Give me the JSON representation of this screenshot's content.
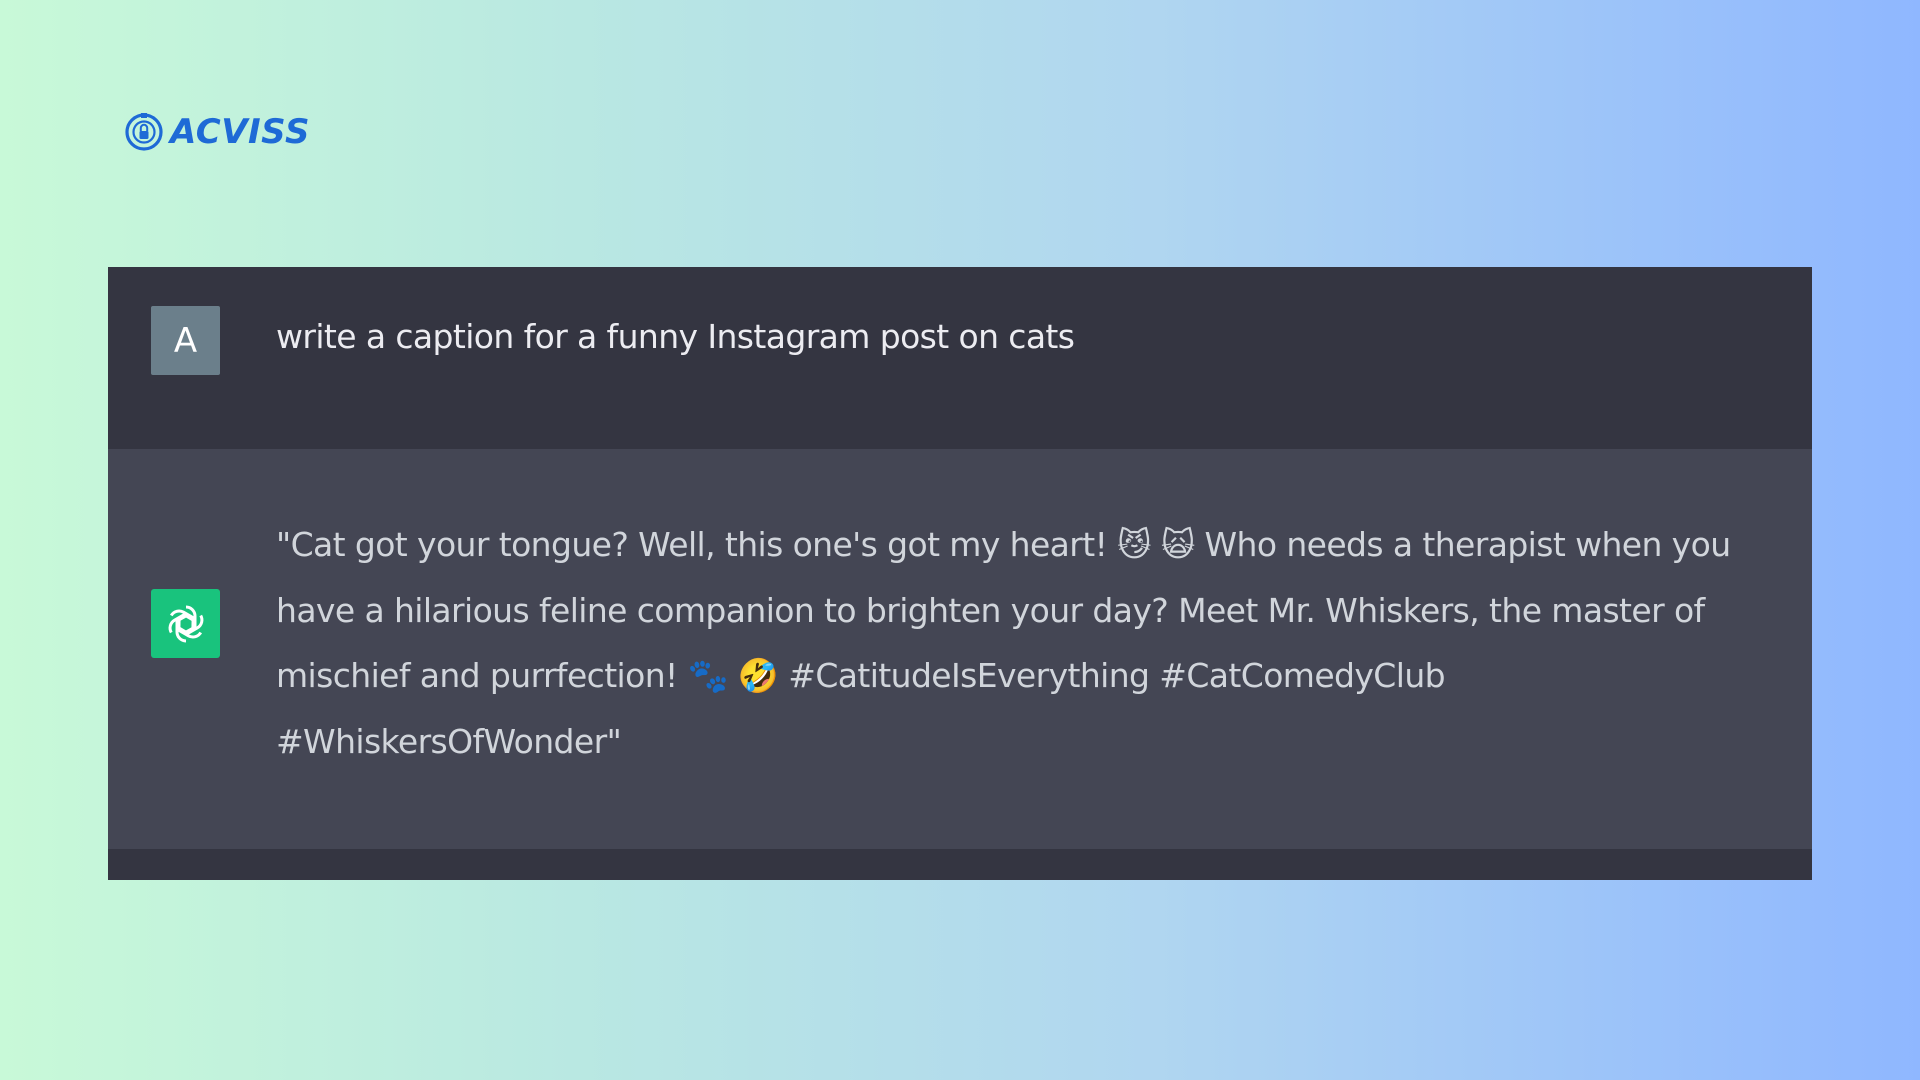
{
  "brand": {
    "name": "ACVISS"
  },
  "conversation": {
    "user_message": {
      "avatar_letter": "A",
      "text": "write a caption for a funny Instagram post on cats"
    },
    "assistant_message": {
      "text": "\"Cat got your tongue? Well, this one's got my heart! 😼 🙀 Who needs a therapist when you have a hilarious feline companion to brighten your day? Meet Mr. Whiskers, the master of mischief and purrfection! 🐾 🤣 #CatitudeIsEverything #CatComedyClub #WhiskersOfWonder\""
    }
  },
  "colors": {
    "brand": "#1e6ad6",
    "user_bg": "#343541",
    "assistant_bg": "#444654",
    "assistant_avatar": "#19c37d",
    "user_avatar": "#6b7f8b"
  },
  "icons": {
    "brand": "lock-shield-icon",
    "assistant": "openai-logo-icon"
  }
}
